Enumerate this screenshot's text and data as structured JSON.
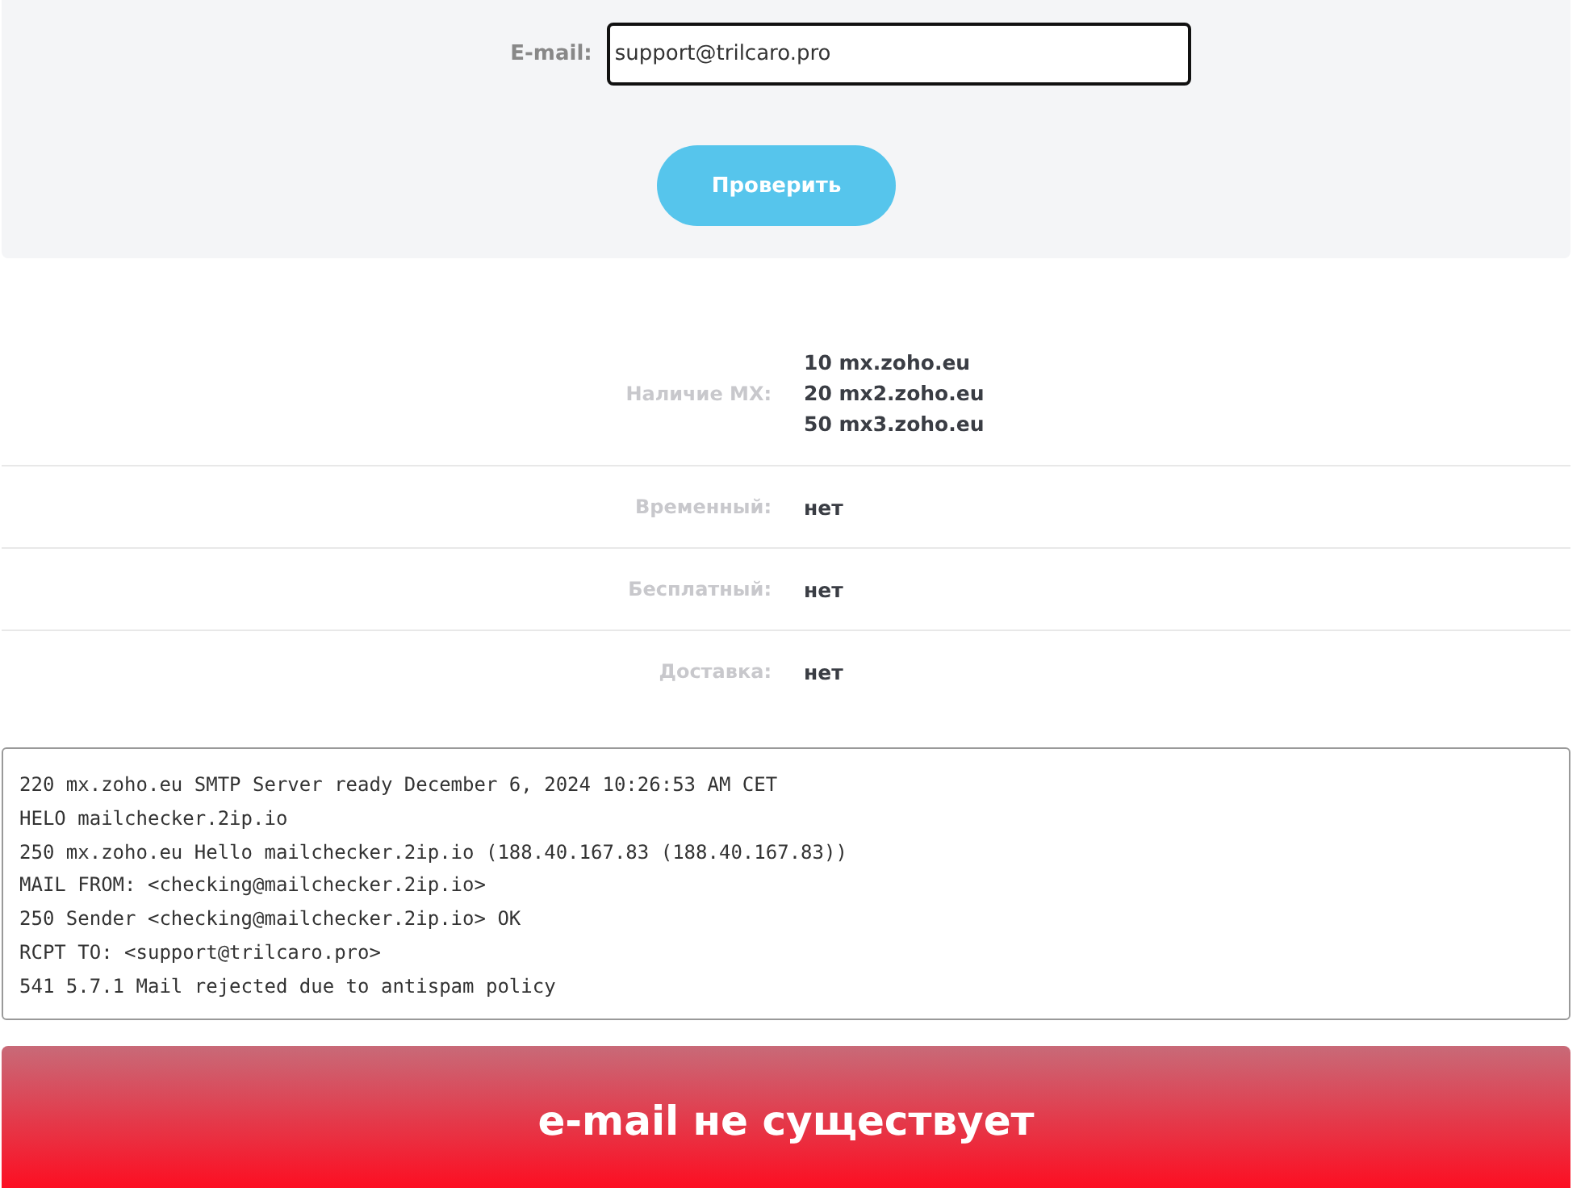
{
  "form": {
    "label": "E-mail:",
    "value": "support@trilcaro.pro",
    "button": "Проверить"
  },
  "results": [
    {
      "label": "Наличие MX:",
      "values": [
        "**10** mx.zoho.eu",
        "**20** mx2.zoho.eu",
        "**50** mx3.zoho.eu"
      ]
    },
    {
      "label": "Временный:",
      "values": [
        "нет"
      ]
    },
    {
      "label": "Бесплатный:",
      "values": [
        "нет"
      ]
    },
    {
      "label": "Доставка:",
      "values": [
        "нет"
      ]
    }
  ],
  "log": [
    "220 mx.zoho.eu SMTP Server ready December 6, 2024 10:26:53 AM CET",
    "HELO mailchecker.2ip.io",
    "250 mx.zoho.eu Hello mailchecker.2ip.io (188.40.167.83 (188.40.167.83))",
    "MAIL FROM: <checking@mailchecker.2ip.io>",
    "250 Sender <checking@mailchecker.2ip.io> OK",
    "RCPT TO: <support@trilcaro.pro>",
    "541 5.7.1 Mail rejected due to antispam policy"
  ],
  "verdict": {
    "error": true,
    "text": "e-mail не существует"
  }
}
